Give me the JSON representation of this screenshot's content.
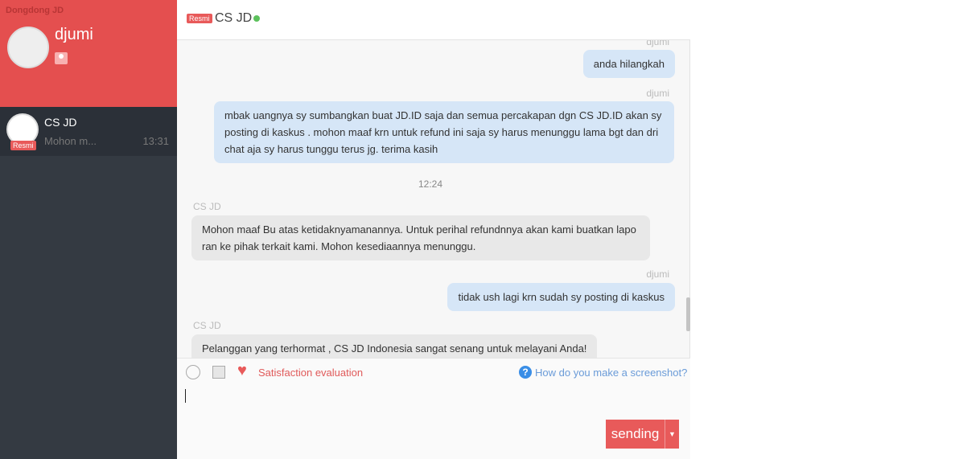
{
  "app_title": "Dongdong JD",
  "user": {
    "name": "djumi"
  },
  "conversations": [
    {
      "name": "CS JD",
      "badge": "Resmi",
      "preview": "Mohon m...",
      "time": "13:31"
    }
  ],
  "header": {
    "badge": "Resmi",
    "title": "CS JD",
    "status_color": "#5cc15c"
  },
  "messages": [
    {
      "sender": "djumi",
      "text": "anda hilangkah"
    },
    {
      "sender": "djumi",
      "text": "mbak uangnya sy sumbangkan buat JD.ID saja dan semua percakapan dgn CS JD.ID akan sy posting di kaskus . mohon maaf krn untuk refund ini saja sy harus menunggu lama bgt dan dri chat aja sy harus tunggu terus jg. terima kasih"
    },
    {
      "time": "12:24"
    },
    {
      "sender": "CS JD",
      "text": "Mohon maaf Bu atas ketidaknyamanannya. Untuk perihal refundnnya akan kami buatkan laporan ke pihak terkait kami. Mohon kesediaannya menunggu."
    },
    {
      "sender": "djumi",
      "text": "tidak ush lagi krn sudah sy posting di kaskus"
    },
    {
      "sender": "CS JD",
      "text": "Pelanggan yang terhormat , CS JD Indonesia sangat senang untuk melayani Anda!"
    }
  ],
  "toolbar": {
    "satisfaction": "Satisfaction evaluation",
    "help": "How do you make a screenshot?"
  },
  "send": {
    "label": "sending"
  },
  "colors": {
    "accent": "#e44f4f",
    "link": "#4a90d9"
  }
}
